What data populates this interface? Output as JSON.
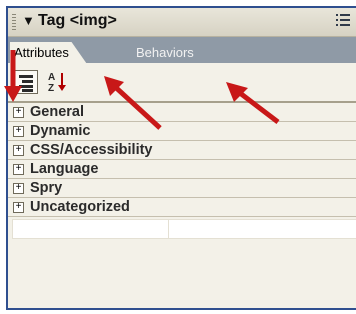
{
  "panel": {
    "title": "Tag <img>",
    "collapse_glyph": "▼",
    "options_icon": "panel-options-icon"
  },
  "tabs": [
    {
      "label": "Attributes",
      "active": true
    },
    {
      "label": "Behaviors",
      "active": false
    }
  ],
  "toolbar": {
    "category_view_icon": "category-view-icon",
    "list_view_label": "A↓ Z"
  },
  "categories": [
    {
      "label": "General"
    },
    {
      "label": "Dynamic"
    },
    {
      "label": "CSS/Accessibility"
    },
    {
      "label": "Language"
    },
    {
      "label": "Spry"
    },
    {
      "label": "Uncategorized"
    }
  ],
  "expander_glyph": "+",
  "annotation_color": "#c81818"
}
